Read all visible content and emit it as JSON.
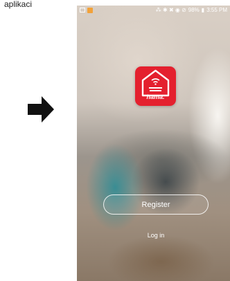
{
  "caption": "aplikaci",
  "status_bar": {
    "right_icons": "⁂ ✱ ✖ ◉ ⊘",
    "battery": "98%",
    "time": "3:55 PM"
  },
  "app": {
    "brand": "hama.",
    "register_label": "Register",
    "login_label": "Log in"
  },
  "colors": {
    "logo_background": "#e4202e",
    "arrow": "#111111"
  },
  "icons": [
    "arrow-right-icon",
    "smart-home-icon",
    "gallery-icon",
    "app-notification-icon"
  ]
}
